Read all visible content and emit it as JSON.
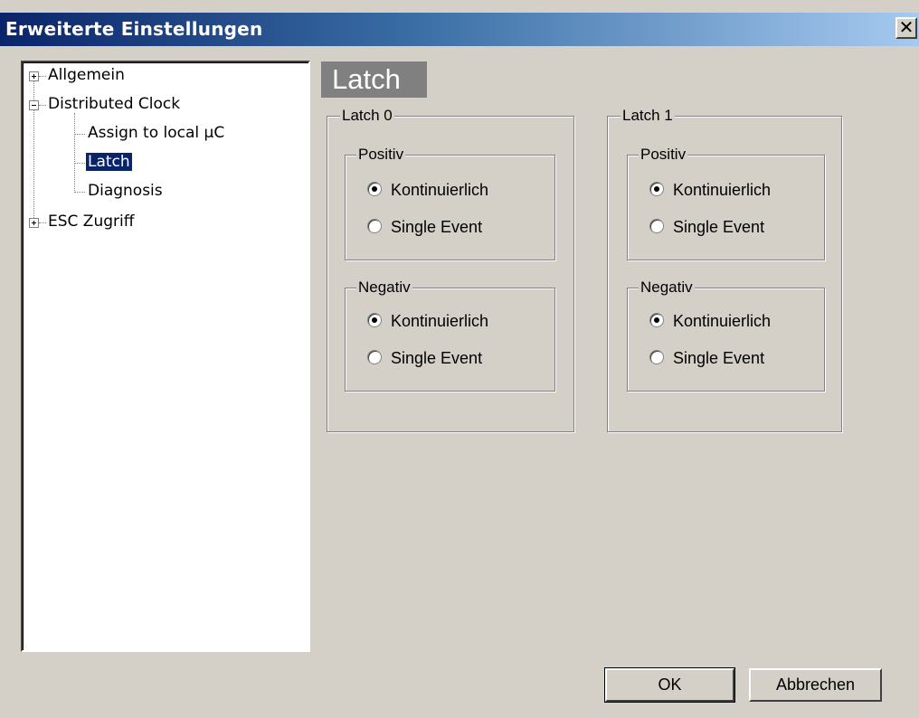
{
  "window": {
    "title": "Erweiterte Einstellungen",
    "close_glyph": "✕"
  },
  "tree": {
    "items": [
      {
        "label": "Allgemein",
        "expander": "plus"
      },
      {
        "label": "Distributed Clock",
        "expander": "minus"
      },
      {
        "label": "Assign to local µC"
      },
      {
        "label": "Latch",
        "selected": true
      },
      {
        "label": "Diagnosis"
      },
      {
        "label": "ESC Zugriff",
        "expander": "plus"
      }
    ]
  },
  "panel": {
    "header": "Latch",
    "latch0": {
      "label": "Latch 0",
      "positive": {
        "label": "Positiv",
        "options": [
          "Kontinuierlich",
          "Single Event"
        ],
        "selected": "Kontinuierlich"
      },
      "negative": {
        "label": "Negativ",
        "options": [
          "Kontinuierlich",
          "Single Event"
        ],
        "selected": "Kontinuierlich"
      }
    },
    "latch1": {
      "label": "Latch 1",
      "positive": {
        "label": "Positiv",
        "options": [
          "Kontinuierlich",
          "Single Event"
        ],
        "selected": "Kontinuierlich"
      },
      "negative": {
        "label": "Negativ",
        "options": [
          "Kontinuierlich",
          "Single Event"
        ],
        "selected": "Kontinuierlich"
      }
    }
  },
  "buttons": {
    "ok": "OK",
    "cancel": "Abbrechen"
  }
}
